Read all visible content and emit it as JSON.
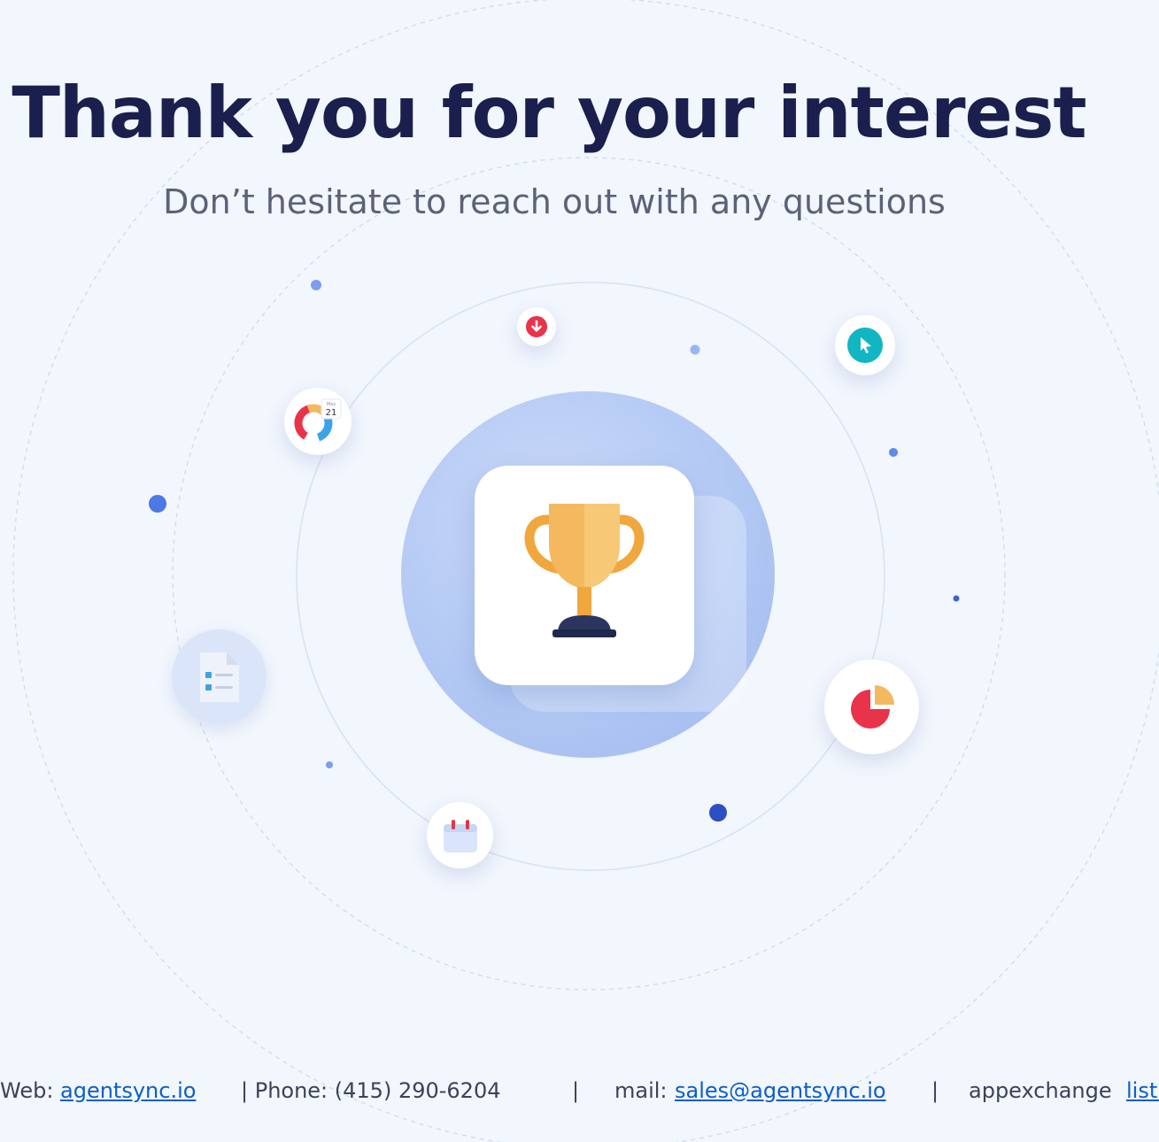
{
  "hero": {
    "title": "Thank you for your interest",
    "subtitle": "Don’t hesitate to reach out with any questions"
  },
  "footer": {
    "web_label": "Web:",
    "web_link": "agentsync.io",
    "phone_text": "| Phone: (415) 290-6204",
    "sep1": "|",
    "mail_label": "mail:",
    "mail_link": "sales@agentsync.io",
    "sep2": "|",
    "appexchange_label": "appexchange",
    "appexchange_link": "listing"
  },
  "icons": {
    "center": "trophy-icon",
    "calendar_date_month": "May",
    "calendar_date_day": "21"
  },
  "colors": {
    "background": "#f2f6fd",
    "title": "#1b1f4d",
    "subtitle": "#5d6178",
    "link": "#0c5ec9",
    "accent_blue": "#4a7be6",
    "accent_red": "#e8334a",
    "accent_teal": "#11b6c3",
    "trophy_gold": "#f4b95f"
  }
}
